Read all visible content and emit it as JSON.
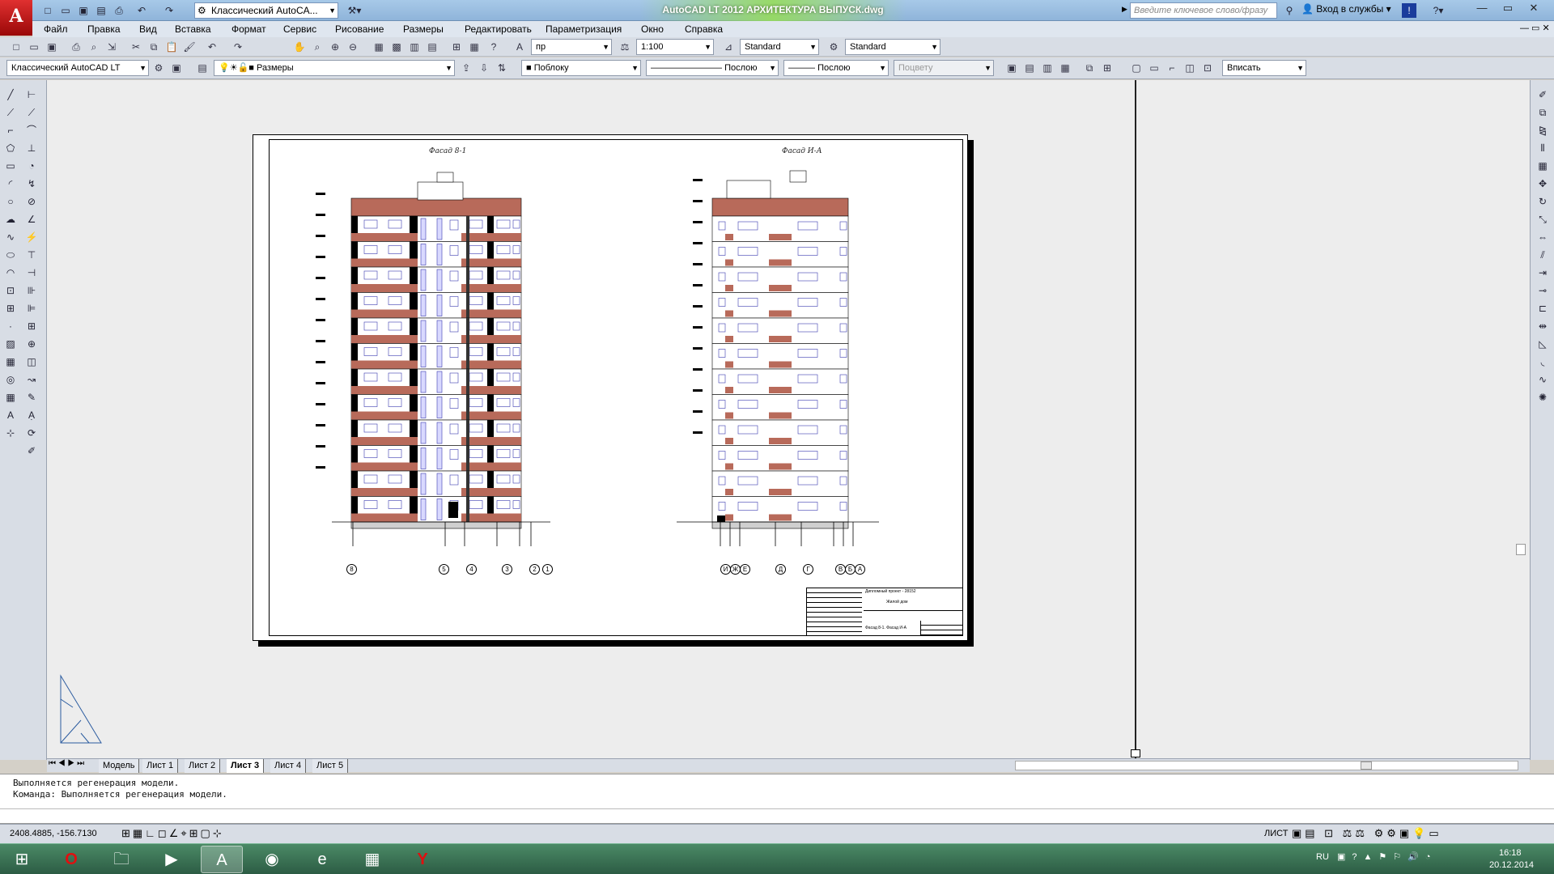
{
  "titlebar": {
    "workspace": "Классический AutoCA...",
    "title": "AutoCAD LT 2012   АРХИТЕКТУРА ВЫПУСК.dwg",
    "search_placeholder": "Введите ключевое слово/фразу",
    "signin": "Вход в службы"
  },
  "menu": [
    "Файл",
    "Правка",
    "Вид",
    "Вставка",
    "Формат",
    "Сервис",
    "Рисование",
    "Размеры",
    "Редактировать",
    "Параметризация",
    "Окно",
    "Справка"
  ],
  "toolbar1": {
    "text_style": "пр",
    "scale": "1:100",
    "dim_style": "Standard",
    "table_style": "Standard"
  },
  "toolbar2": {
    "workspace": "Классический AutoCAD LT",
    "layer": "Размеры",
    "color": "Поблоку",
    "linetype": "Послою",
    "lineweight": "Послою",
    "plotstyle": "Поцвету",
    "viewport_scale": "Вписать"
  },
  "drawing": {
    "facade1_title": "Фасад 8-1",
    "facade2_title": "Фасад И-А",
    "axes1": [
      "8",
      "5",
      "4",
      "3",
      "2",
      "1"
    ],
    "axes2": [
      "И",
      "Ж",
      "Е",
      "Д",
      "Г",
      "В",
      "Б",
      "А"
    ],
    "stamp_project": "Дипломный проект - 28152",
    "stamp_name": "Жилой дом",
    "stamp_sheet": "Фасад 8-1. Фасад И-А"
  },
  "tabs": [
    "Модель",
    "Лист 1",
    "Лист 2",
    "Лист 3",
    "Лист 4",
    "Лист 5"
  ],
  "active_tab": "Лист 3",
  "command": {
    "line1": "Выполняется регенерация модели.",
    "line2": "Команда: Выполняется регенерация модели."
  },
  "status": {
    "coords": "2408.4885, -156.7130",
    "mode": "ЛИСТ"
  },
  "tray": {
    "lang": "RU",
    "time": "16:18",
    "date": "20.12.2014"
  },
  "colors": {
    "brick": "#b86a5a",
    "window": "#3a3ab0",
    "accent_title": "#96dc5a",
    "taskbar": "#2c5c44"
  }
}
